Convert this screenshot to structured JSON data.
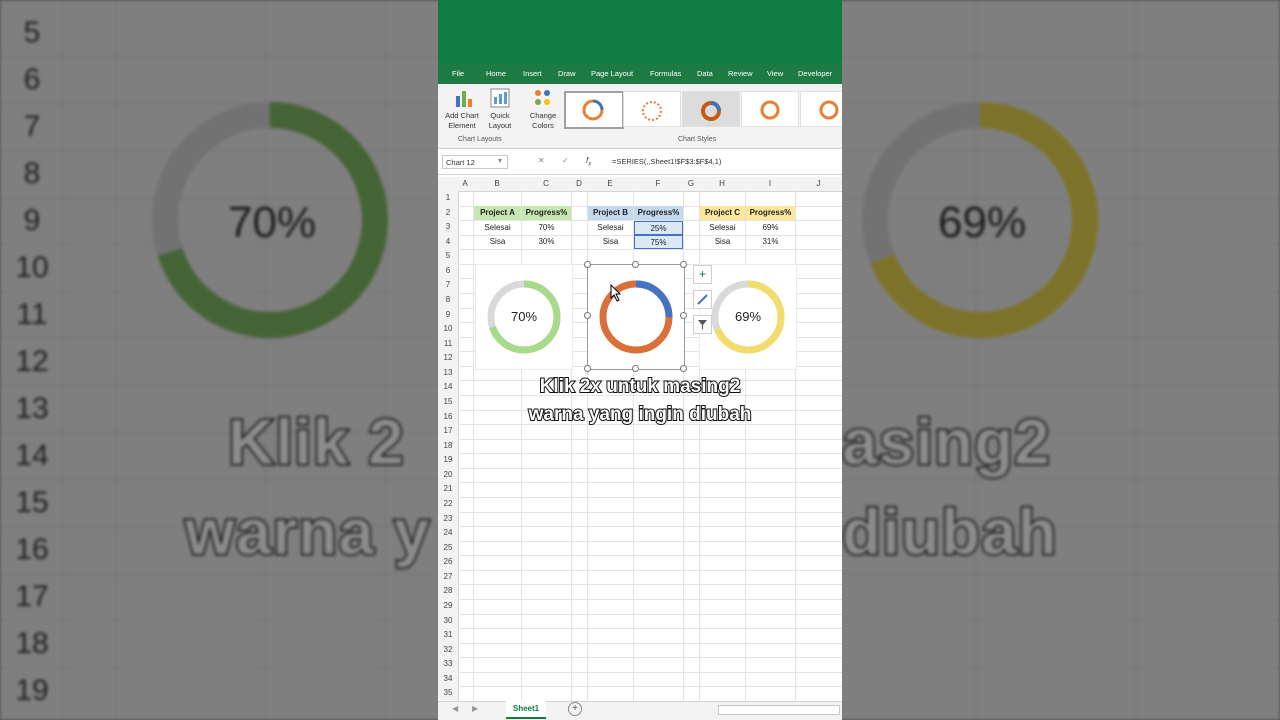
{
  "menu": [
    "File",
    "Home",
    "Insert",
    "Draw",
    "Page Layout",
    "Formulas",
    "Data",
    "Review",
    "View",
    "Developer"
  ],
  "ribbon": {
    "add_chart_element": [
      "Add Chart",
      "Element"
    ],
    "quick_layout": [
      "Quick",
      "Layout"
    ],
    "change_colors": [
      "Change",
      "Colors"
    ],
    "group_chart_layouts": "Chart Layouts",
    "group_chart_styles": "Chart Styles"
  },
  "formula_bar": {
    "name_box": "Chart 12",
    "formula": "=SERIES(,,Sheet1!$F$3:$F$4,1)"
  },
  "columns": [
    "A",
    "B",
    "C",
    "D",
    "E",
    "F",
    "G",
    "H",
    "I",
    "J"
  ],
  "rows": [
    "1",
    "2",
    "3",
    "4",
    "5",
    "6",
    "7",
    "8",
    "9",
    "10",
    "11",
    "12",
    "13",
    "14",
    "15",
    "16",
    "17",
    "18",
    "19",
    "20",
    "21",
    "22",
    "23",
    "24",
    "25",
    "26",
    "27",
    "28",
    "29",
    "30",
    "31",
    "32",
    "33",
    "34",
    "35"
  ],
  "tables": {
    "a": {
      "h1": "Project A",
      "h2": "Progress%",
      "r1c1": "Selesai",
      "r1c2": "70%",
      "r2c1": "Sisa",
      "r2c2": "30%"
    },
    "b": {
      "h1": "Project B",
      "h2": "Progress%",
      "r1c1": "Selesai",
      "r1c2": "25%",
      "r2c1": "Sisa",
      "r2c2": "75%"
    },
    "c": {
      "h1": "Project C",
      "h2": "Progress%",
      "r1c1": "Selesai",
      "r1c2": "69%",
      "r2c1": "Sisa",
      "r2c2": "31%"
    }
  },
  "donuts": {
    "a": {
      "label": "70%",
      "done": 0.7,
      "done_color": "#a9d98a",
      "rest_color": "#d9d9d9"
    },
    "b": {
      "done": 0.25,
      "done_color": "#4472c4",
      "rest_color": "#d9703a"
    },
    "c": {
      "label": "69%",
      "done": 0.69,
      "done_color": "#f2dc6b",
      "rest_color": "#d9d9d9"
    }
  },
  "caption": {
    "line1": "Klik 2x untuk masing2",
    "line2": "warna yang ingin diubah"
  },
  "sheet_tab": "Sheet1",
  "background": {
    "row_labels": [
      "5",
      "6",
      "7",
      "8",
      "9",
      "10",
      "11",
      "12",
      "13",
      "14",
      "15",
      "16",
      "17",
      "18",
      "19"
    ],
    "left_pct": "70%",
    "right_pct": "69%",
    "caption_line1_left": "Klik 2",
    "caption_line1_right": "asing2",
    "caption_line2_left": "warna y",
    "caption_line2_right": "diubah"
  },
  "colors": {
    "excel_green": "#107c41"
  }
}
